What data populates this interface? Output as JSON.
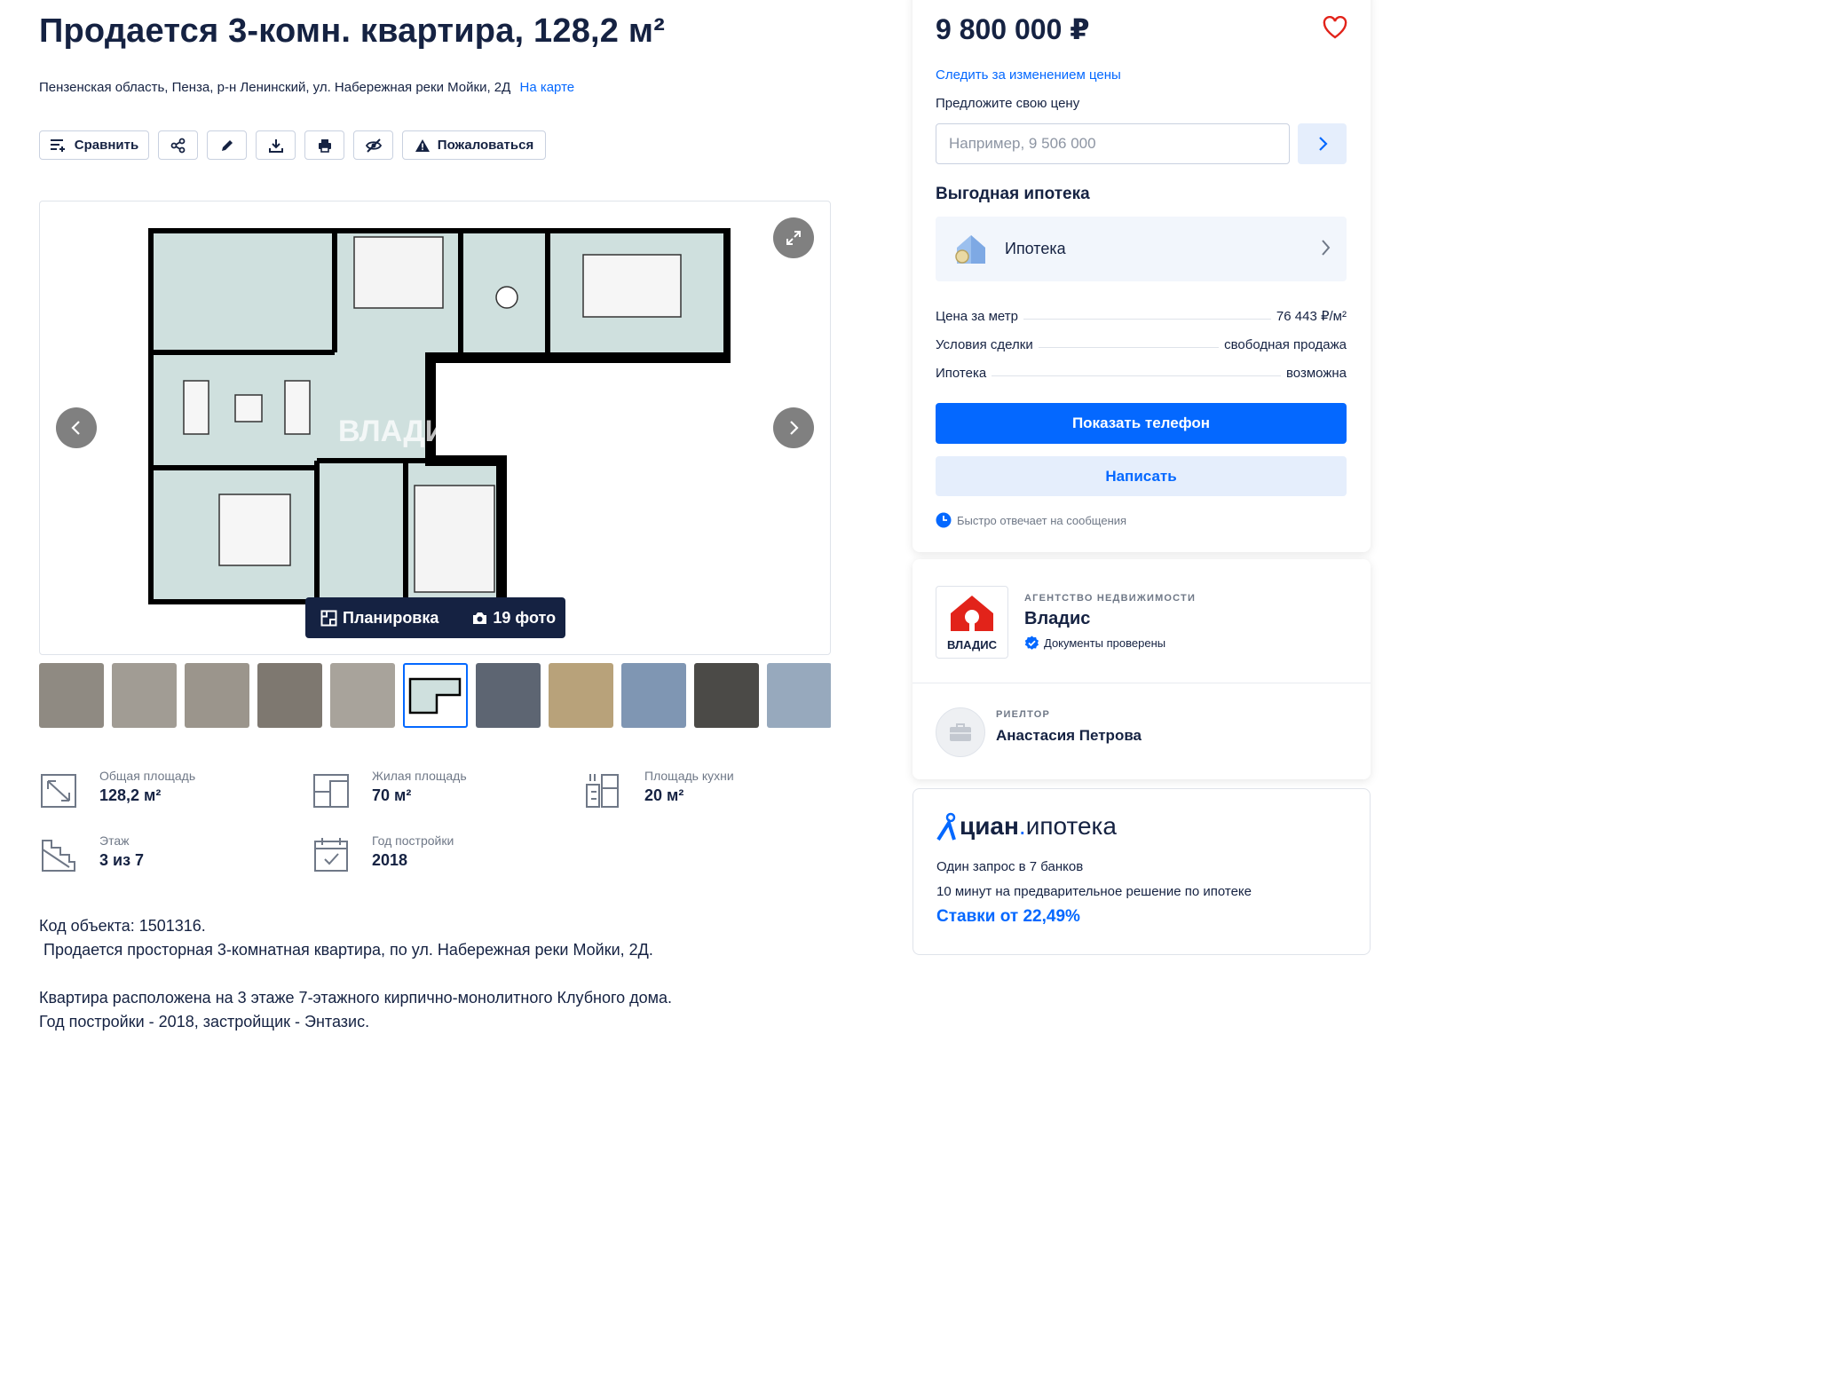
{
  "listing": {
    "title": "Продается 3-комн. квартира, 128,2 м²",
    "address": "Пензенская область, Пенза, р-н Ленинский, ул. Набережная реки Мойки, 2Д",
    "map_link": "На карте"
  },
  "toolbar": {
    "compare_label": "Сравнить",
    "complain_label": "Пожаловаться",
    "icons": [
      "compare-icon",
      "share-icon",
      "edit-icon",
      "download-icon",
      "print-icon",
      "hide-icon",
      "warning-icon"
    ]
  },
  "gallery": {
    "plan_tab": "Планировка",
    "photos_tab": "19 фото",
    "watermark": "ВЛАДИС",
    "thumbnails": [
      {
        "color": "#8f8a82"
      },
      {
        "color": "#a19c94"
      },
      {
        "color": "#9b958c"
      },
      {
        "color": "#7e7870"
      },
      {
        "color": "#a8a39b"
      },
      {
        "color": "#ffffff",
        "active": true
      },
      {
        "color": "#5d6572"
      },
      {
        "color": "#b8a27a"
      },
      {
        "color": "#7f96b3"
      },
      {
        "color": "#4b4a47"
      },
      {
        "color": "#97a9bd"
      }
    ]
  },
  "facts": [
    {
      "label": "Общая площадь",
      "value": "128,2 м²",
      "icon": "area-icon"
    },
    {
      "label": "Жилая площадь",
      "value": "70 м²",
      "icon": "living-area-icon"
    },
    {
      "label": "Площадь кухни",
      "value": "20 м²",
      "icon": "kitchen-icon"
    },
    {
      "label": "Этаж",
      "value": "3 из 7",
      "icon": "stairs-icon"
    },
    {
      "label": "Год постройки",
      "value": "2018",
      "icon": "calendar-icon"
    }
  ],
  "description": {
    "line1": "Код объекта: 1501316.",
    "line2": " Продается просторная 3-комнатная квартира, по ул. Набережная реки Мойки, 2Д.",
    "line3": "Квартира расположена на 3 этаже 7-этажного кирпично-монолитного Клубного дома.",
    "line4": "Год постройки - 2018, застройщик - Энтазис."
  },
  "price_card": {
    "price": "9 800 000 ₽",
    "follow_price": "Следить за изменением цены",
    "offer_label": "Предложите свою цену",
    "offer_placeholder": "Например, 9 506 000",
    "mortgage_title": "Выгодная ипотека",
    "mortgage_label": "Ипотека",
    "details": [
      {
        "key": "Цена за метр",
        "value": "76 443 ₽/м²"
      },
      {
        "key": "Условия сделки",
        "value": "свободная продажа"
      },
      {
        "key": "Ипотека",
        "value": "возможна"
      }
    ],
    "phone_button": "Показать телефон",
    "write_button": "Написать",
    "fast_reply": "Быстро отвечает на сообщения"
  },
  "agency_card": {
    "agency_type": "АГЕНТСТВО НЕДВИЖИМОСТИ",
    "agency_name": "Владис",
    "logo_text": "ВЛАДИС",
    "verified": "Документы проверены",
    "realtor_type": "РИЕЛТОР",
    "realtor_name": "Анастасия Петрова"
  },
  "cian_card": {
    "logo_bold": "циан",
    "logo_dot": ".",
    "logo_rest": "ипотека",
    "line1": "Один запрос в 7 банков",
    "line2": "10 минут на предварительное решение по ипотеке",
    "rates": "Ставки от 22,49%"
  },
  "colors": {
    "accent": "#0468ff",
    "text": "#152242",
    "muted": "#6f7887",
    "light_blue": "#e5eefc",
    "brand_red": "#e2231a"
  }
}
